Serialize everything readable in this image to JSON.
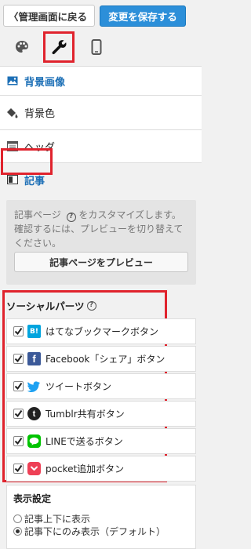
{
  "topbar": {
    "back_label": "〈管理画面に戻る",
    "save_label": "変更を保存する"
  },
  "tabs": [
    {
      "icon": "palette-icon"
    },
    {
      "icon": "wrench-icon",
      "active": true
    },
    {
      "icon": "mobile-icon"
    }
  ],
  "sections": {
    "bg_image": "背景画像",
    "bg_color": "背景色",
    "header": "ヘッダ",
    "article": "記事"
  },
  "article_panel": {
    "desc_part1": "記事ページ",
    "desc_part2": "をカスタマイズします。確認するには、プレビューを切り替えてください。",
    "preview_button": "記事ページをプレビュー"
  },
  "social": {
    "title": "ソーシャルパーツ",
    "items": [
      {
        "label": "はてなブックマークボタン",
        "checked": true,
        "icon": "hatena-icon",
        "color": "#00a4de"
      },
      {
        "label": "Facebook「シェア」ボタン",
        "checked": true,
        "icon": "facebook-icon",
        "color": "#3b5998"
      },
      {
        "label": "ツイートボタン",
        "checked": true,
        "icon": "twitter-icon",
        "color": "#1da1f2"
      },
      {
        "label": "Tumblr共有ボタン",
        "checked": true,
        "icon": "tumblr-icon",
        "color": "#222"
      },
      {
        "label": "LINEで送るボタン",
        "checked": true,
        "icon": "line-icon",
        "color": "#00c300"
      },
      {
        "label": "pocket追加ボタン",
        "checked": true,
        "icon": "pocket-icon",
        "color": "#ee4056"
      }
    ]
  },
  "display": {
    "title": "表示設定",
    "options": [
      {
        "label": "記事上下に表示",
        "selected": false
      },
      {
        "label": "記事下にのみ表示（デフォルト）",
        "selected": true
      }
    ]
  },
  "colors": {
    "accent": "#2c8fd9",
    "highlight": "#e0232d",
    "link": "#1c6fb6"
  }
}
